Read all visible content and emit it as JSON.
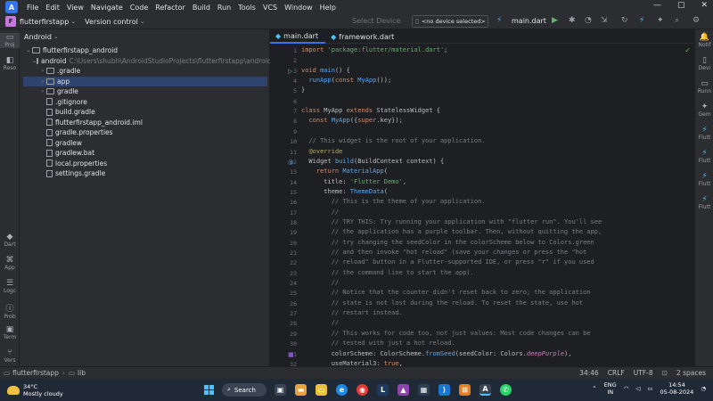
{
  "menubar": {
    "items": [
      "File",
      "Edit",
      "View",
      "Navigate",
      "Code",
      "Refactor",
      "Build",
      "Run",
      "Tools",
      "VCS",
      "Window",
      "Help"
    ],
    "window_controls": [
      "—",
      "▢",
      "✕"
    ]
  },
  "toolbar": {
    "project_badge": "F",
    "project_name": "flutterfirstapp",
    "vcs_label": "Version control",
    "select_device": "Select Device",
    "device_selector": "<no device selected>",
    "run_config": "main.dart"
  },
  "left_strip": {
    "items": [
      {
        "label": "Proj",
        "icon": "folder-icon"
      },
      {
        "label": "Reso",
        "icon": "resource-icon"
      },
      {
        "label": "Dart",
        "icon": "dart-icon"
      },
      {
        "label": "App",
        "icon": "app-icon"
      },
      {
        "label": "Logc",
        "icon": "logcat-icon"
      },
      {
        "label": "Prob",
        "icon": "problems-icon"
      },
      {
        "label": "Term",
        "icon": "terminal-icon"
      },
      {
        "label": "Vers",
        "icon": "version-icon"
      }
    ]
  },
  "project": {
    "view": "Android",
    "tree": [
      {
        "label": "flutterfirstapp_android",
        "depth": 0,
        "kind": "folder",
        "expanded": true
      },
      {
        "label": "android",
        "path": "C:\\Users\\shubh\\AndroidStudioProjects\\flutterfirstapp\\android",
        "depth": 1,
        "kind": "folder",
        "expanded": true
      },
      {
        "label": ".gradle",
        "depth": 2,
        "kind": "folder",
        "expanded": false
      },
      {
        "label": "app",
        "depth": 2,
        "kind": "folder",
        "expanded": false,
        "selected": true
      },
      {
        "label": "gradle",
        "depth": 2,
        "kind": "folder",
        "expanded": false
      },
      {
        "label": ".gitignore",
        "depth": 2,
        "kind": "file"
      },
      {
        "label": "build.gradle",
        "depth": 2,
        "kind": "file"
      },
      {
        "label": "flutterfirstapp_android.iml",
        "depth": 2,
        "kind": "file"
      },
      {
        "label": "gradle.properties",
        "depth": 2,
        "kind": "file"
      },
      {
        "label": "gradlew",
        "depth": 2,
        "kind": "file"
      },
      {
        "label": "gradlew.bat",
        "depth": 2,
        "kind": "file"
      },
      {
        "label": "local.properties",
        "depth": 2,
        "kind": "file"
      },
      {
        "label": "settings.gradle",
        "depth": 2,
        "kind": "file"
      }
    ]
  },
  "editor": {
    "tabs": [
      {
        "label": "main.dart",
        "active": true
      },
      {
        "label": "framework.dart",
        "active": false
      }
    ],
    "lines": [
      {
        "n": "1",
        "html": "<span class=\"kw\">import</span> <span class=\"str\">'package:flutter/material.dart'</span>;"
      },
      {
        "n": "2",
        "html": ""
      },
      {
        "n": "3",
        "html": "<span class=\"kw\">void</span> <span class=\"fn\">main</span>() {",
        "mark": "run"
      },
      {
        "n": "4",
        "html": "  <span class=\"fn\">runApp</span>(<span class=\"kw\">const</span> <span class=\"fn\">MyApp</span>());"
      },
      {
        "n": "5",
        "html": "}"
      },
      {
        "n": "6",
        "html": ""
      },
      {
        "n": "7",
        "html": "<span class=\"kw\">class</span> MyApp <span class=\"kw\">extends</span> StatelessWidget {"
      },
      {
        "n": "8",
        "html": "  <span class=\"kw\">const</span> <span class=\"fn\">MyApp</span>({<span class=\"kw\">super</span>.key});"
      },
      {
        "n": "9",
        "html": ""
      },
      {
        "n": "10",
        "html": "  <span class=\"cm\">// This widget is the root of your application.</span>"
      },
      {
        "n": "11",
        "html": "  <span class=\"ann\">@override</span>"
      },
      {
        "n": "12",
        "html": "  Widget <span class=\"fn\">build</span>(BuildContext context) {",
        "mark": "override"
      },
      {
        "n": "13",
        "html": "    <span class=\"kw\">return</span> <span class=\"fn\">MaterialApp</span>("
      },
      {
        "n": "14",
        "html": "      title: <span class=\"str\">'Flutter Demo'</span>,"
      },
      {
        "n": "15",
        "html": "      theme: <span class=\"fn\">ThemeData</span>("
      },
      {
        "n": "16",
        "html": "        <span class=\"cm\">// This is the theme of your application.</span>"
      },
      {
        "n": "17",
        "html": "        <span class=\"cm\">//</span>"
      },
      {
        "n": "18",
        "html": "        <span class=\"cm\">// TRY THIS: Try running your application with \"flutter run\". You'll see</span>"
      },
      {
        "n": "19",
        "html": "        <span class=\"cm\">// the application has a purple toolbar. Then, without quitting the app,</span>"
      },
      {
        "n": "20",
        "html": "        <span class=\"cm\">// try changing the seedColor in the colorScheme below to Colors.green</span>"
      },
      {
        "n": "21",
        "html": "        <span class=\"cm\">// and then invoke \"hot reload\" (save your changes or press the \"hot</span>"
      },
      {
        "n": "22",
        "html": "        <span class=\"cm\">// reload\" button in a Flutter-supported IDE, or press \"r\" if you used</span>"
      },
      {
        "n": "23",
        "html": "        <span class=\"cm\">// the command line to start the app).</span>"
      },
      {
        "n": "24",
        "html": "        <span class=\"cm\">//</span>"
      },
      {
        "n": "25",
        "html": "        <span class=\"cm\">// Notice that the counter didn't reset back to zero; the application</span>"
      },
      {
        "n": "26",
        "html": "        <span class=\"cm\">// state is not lost during the reload. To reset the state, use hot</span>"
      },
      {
        "n": "27",
        "html": "        <span class=\"cm\">// restart instead.</span>"
      },
      {
        "n": "28",
        "html": "        <span class=\"cm\">//</span>"
      },
      {
        "n": "29",
        "html": "        <span class=\"cm\">// This works for code too, not just values: Most code changes can be</span>"
      },
      {
        "n": "30",
        "html": "        <span class=\"cm\">// tested with just a hot reload.</span>"
      },
      {
        "n": "31",
        "html": "        colorScheme: ColorScheme.<span class=\"fn\">fromSeed</span>(seedColor: Colors.<span class=\"it\">deepPurple</span>),",
        "mark": "color"
      },
      {
        "n": "32",
        "html": "        useMaterial3: <span class=\"kw\">true</span>,"
      }
    ]
  },
  "right_strip": {
    "items": [
      {
        "label": "Notif",
        "icon": "bell-icon"
      },
      {
        "label": "Devi",
        "icon": "device-icon"
      },
      {
        "label": "Runn",
        "icon": "running-devices-icon"
      },
      {
        "label": "Gem",
        "icon": "gemini-icon"
      },
      {
        "label": "Flutt",
        "icon": "flutter-icon"
      },
      {
        "label": "Flutt",
        "icon": "flutter-icon"
      },
      {
        "label": "Flutt",
        "icon": "flutter-icon"
      },
      {
        "label": "Flutt",
        "icon": "flutter-icon"
      }
    ]
  },
  "statusbar": {
    "crumbs": [
      "flutterfirstapp",
      "lib"
    ],
    "position": "34:46",
    "line_sep": "CRLF",
    "encoding": "UTF-8",
    "indent": "2 spaces"
  },
  "taskbar": {
    "temp": "34°C",
    "weather": "Mostly cloudy",
    "search": "Search",
    "lang": "ENG",
    "region": "IN",
    "time": "14:54",
    "date": "05-08-2024"
  },
  "colors": {
    "accent": "#3574f0",
    "selection": "#2e436e",
    "flutter": "#4fc3f7"
  }
}
